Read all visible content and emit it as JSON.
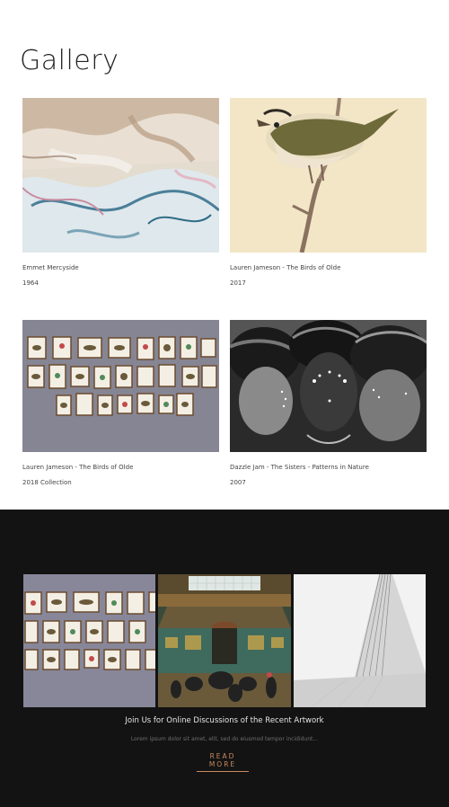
{
  "page": {
    "title": "Gallery"
  },
  "gallery": {
    "items": [
      {
        "caption": "Emmet Mercyside",
        "sub": "1964",
        "image": "abstract-paint-image"
      },
      {
        "caption": "Lauren Jameson - The Birds of Olde",
        "sub": "2017",
        "image": "bird-illustration-image"
      },
      {
        "caption": "Lauren Jameson - The Birds of Olde",
        "sub": "2018 Collection",
        "image": "framed-birds-wall-image"
      },
      {
        "caption": "Dazzle Jam - The Sisters - Patterns in Nature",
        "sub": "2007",
        "image": "three-women-portrait-image"
      }
    ]
  },
  "promo": {
    "images": [
      "framed-birds-wall-image",
      "museum-hall-image",
      "architecture-image"
    ],
    "title": "Join Us for Online Discussions of the Recent Artwork",
    "text": "Lorem ipsum dolor sit amet, elit, sed do eiusmod tempor incididunt...",
    "link": "READ MORE"
  },
  "colors": {
    "dark_bg": "#131313",
    "accent": "#c9895f"
  }
}
